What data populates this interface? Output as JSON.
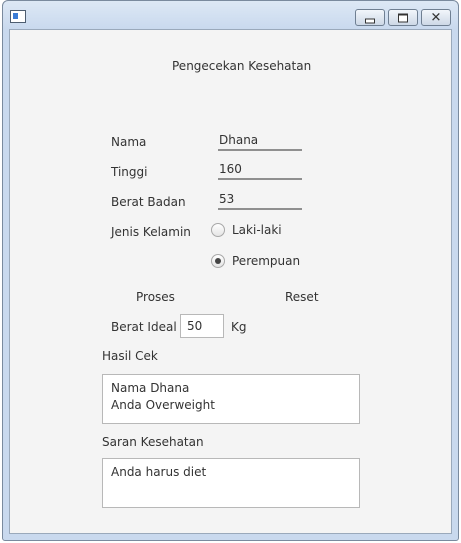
{
  "window": {
    "controls": {
      "minimize": "minimize-icon",
      "maximize": "maximize-icon",
      "close": "close-icon"
    }
  },
  "form": {
    "title": "Pengecekan Kesehatan",
    "nama_label": "Nama",
    "nama_value": "Dhana",
    "tinggi_label": "Tinggi",
    "tinggi_value": "160",
    "berat_label": "Berat Badan",
    "berat_value": "53",
    "jenis_label": "Jenis Kelamin",
    "gender_options": [
      "Laki-laki",
      "Perempuan"
    ],
    "gender_selected": "Perempuan",
    "proses_label": "Proses",
    "reset_label": "Reset",
    "berat_ideal_label": "Berat Ideal",
    "berat_ideal_value": "50",
    "berat_ideal_unit": "Kg",
    "hasil_label": "Hasil Cek",
    "hasil_lines": [
      "Nama Dhana",
      "Anda Overweight"
    ],
    "saran_label": "Saran Kesehatan",
    "saran_lines": [
      "Anda harus diet"
    ]
  }
}
